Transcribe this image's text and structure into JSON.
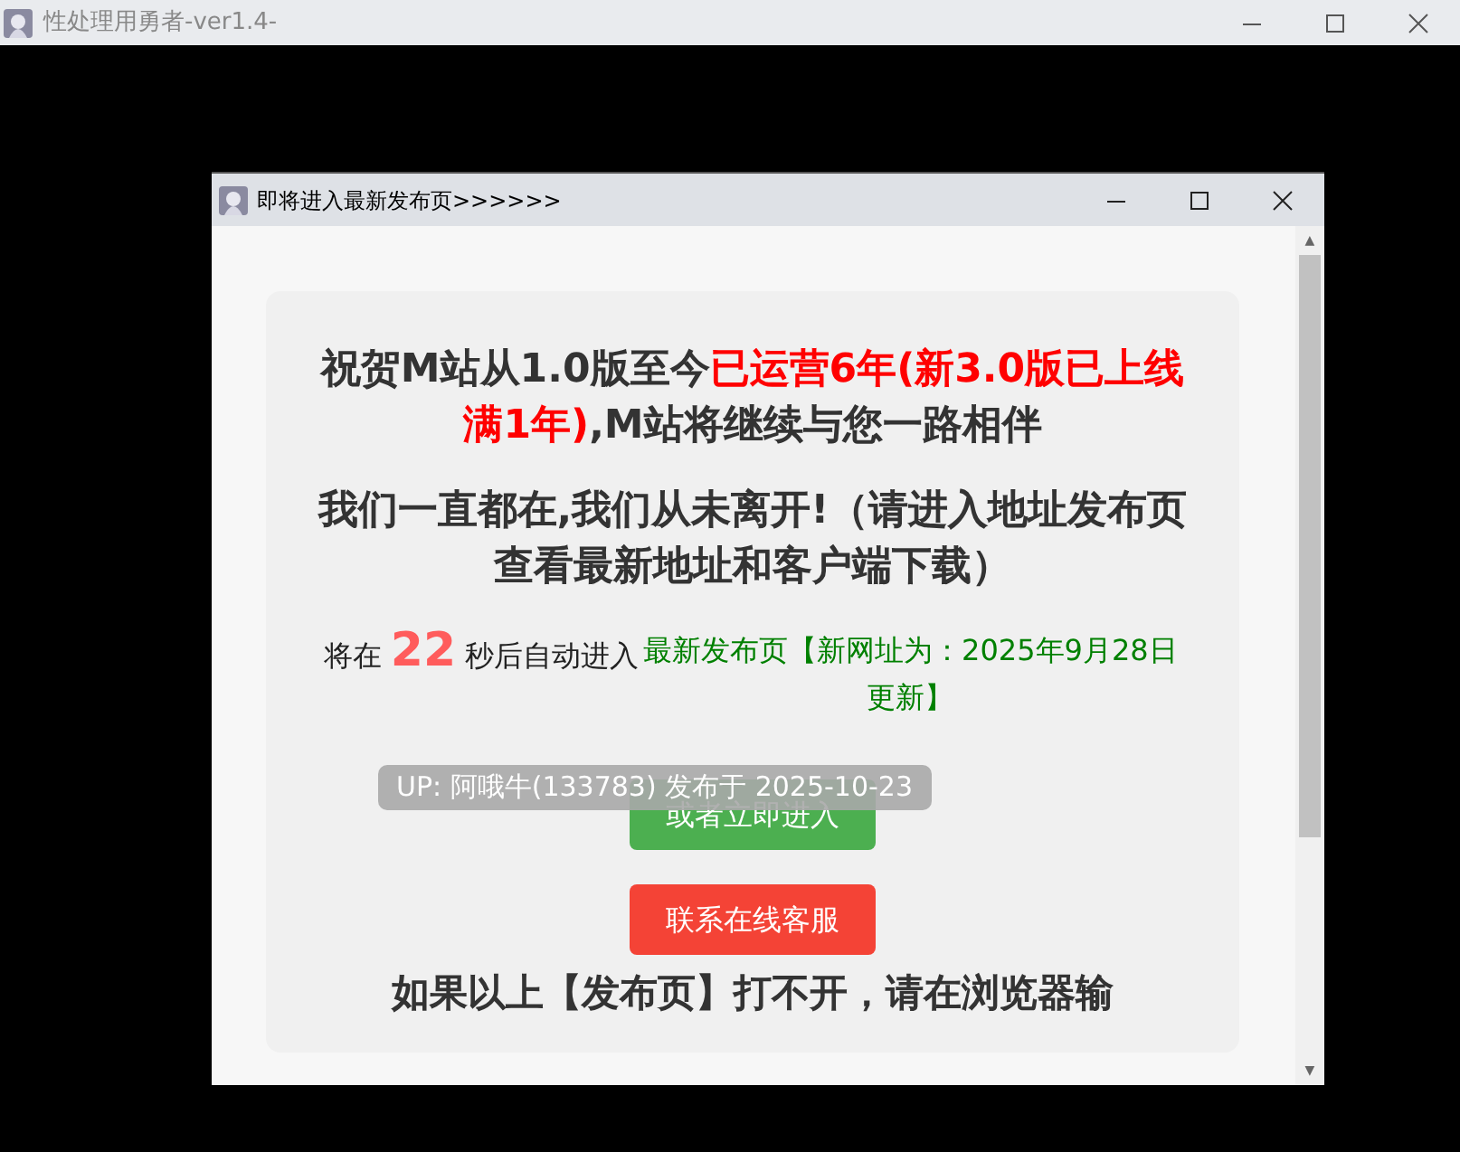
{
  "window": {
    "title": "性处理用勇者-ver1.4-"
  },
  "dialog": {
    "title": "即将进入最新发布页>>>>>>",
    "headline": [
      {
        "kind": "normal",
        "text": "祝贺M站从1.0版至今"
      },
      {
        "kind": "highlight",
        "text": "已运营6年(新3.0版已上线满1年)"
      },
      {
        "kind": "normal",
        "text": ",M站将继续与您一路相伴"
      }
    ],
    "subheadline": "我们一直都在,我们从未离开!（请进入地址发布页查看最新地址和客户端下载）",
    "countdown": {
      "before": "将在",
      "seconds": "22",
      "after": "秒后自动进入",
      "link": "最新发布页【新网址为：2025年9月28日更新】"
    },
    "tooltip": "UP: 阿哦牛(133783) 发布于 2025-10-23",
    "buttons": [
      {
        "kind": "enter",
        "label": "或者立即进入"
      },
      {
        "kind": "support",
        "label": "联系在线客服"
      }
    ],
    "footer": "如果以上【发布页】打不开，请在浏览器输"
  },
  "scrollbar": {
    "up": "▲",
    "down": "▼"
  }
}
